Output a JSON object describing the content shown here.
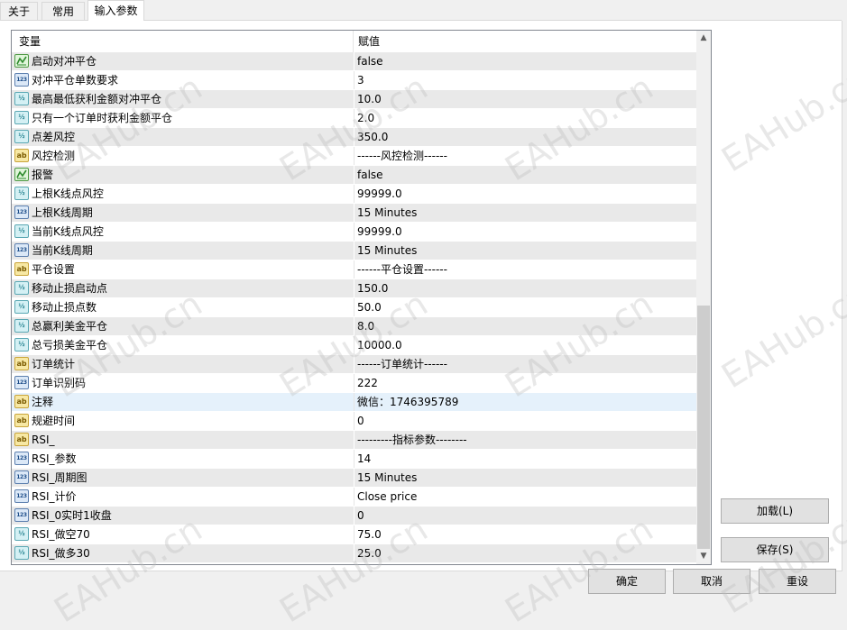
{
  "tabs": [
    {
      "label": "关于"
    },
    {
      "label": "常用"
    },
    {
      "label": "输入参数"
    }
  ],
  "grid": {
    "header": {
      "variable": "变量",
      "value": "赋值"
    },
    "rows": [
      {
        "icon": "bool",
        "name": "启动对冲平仓",
        "value": "false"
      },
      {
        "icon": "int",
        "name": "对冲平仓单数要求",
        "value": "3"
      },
      {
        "icon": "double",
        "name": "最高最低获利金额对冲平仓",
        "value": "10.0"
      },
      {
        "icon": "double",
        "name": "只有一个订单时获利金额平仓",
        "value": "2.0"
      },
      {
        "icon": "double",
        "name": "点差风控",
        "value": "350.0"
      },
      {
        "icon": "string",
        "name": "风控检测",
        "value": "------风控检测------"
      },
      {
        "icon": "bool",
        "name": "报警",
        "value": "false"
      },
      {
        "icon": "double",
        "name": "上根K线点风控",
        "value": "99999.0"
      },
      {
        "icon": "int",
        "name": "上根K线周期",
        "value": "15 Minutes"
      },
      {
        "icon": "double",
        "name": "当前K线点风控",
        "value": "99999.0"
      },
      {
        "icon": "int",
        "name": "当前K线周期",
        "value": "15 Minutes"
      },
      {
        "icon": "string",
        "name": "平仓设置",
        "value": "------平仓设置------"
      },
      {
        "icon": "double",
        "name": "移动止损启动点",
        "value": "150.0"
      },
      {
        "icon": "double",
        "name": "移动止损点数",
        "value": "50.0"
      },
      {
        "icon": "double",
        "name": "总赢利美金平仓",
        "value": "8.0"
      },
      {
        "icon": "double",
        "name": "总亏损美金平仓",
        "value": "10000.0"
      },
      {
        "icon": "string",
        "name": "订单统计",
        "value": "------订单统计------"
      },
      {
        "icon": "int",
        "name": "订单识别码",
        "value": "222"
      },
      {
        "icon": "string",
        "name": "注释",
        "value": "微信：1746395789",
        "selected": true
      },
      {
        "icon": "string",
        "name": "规避时间",
        "value": "0"
      },
      {
        "icon": "string",
        "name": "RSI_",
        "value": "---------指标参数--------"
      },
      {
        "icon": "int",
        "name": "RSI_参数",
        "value": "14"
      },
      {
        "icon": "int",
        "name": "RSI_周期图",
        "value": "15 Minutes"
      },
      {
        "icon": "int",
        "name": "RSI_计价",
        "value": "Close price"
      },
      {
        "icon": "int",
        "name": "RSI_0实时1收盘",
        "value": "0"
      },
      {
        "icon": "double",
        "name": "RSI_做空70",
        "value": "75.0"
      },
      {
        "icon": "double",
        "name": "RSI_做多30",
        "value": "25.0"
      }
    ]
  },
  "icons": {
    "int": "123",
    "double": "½",
    "string": "ab",
    "bool": "bool-icon"
  },
  "buttons": {
    "load": "加载(L)",
    "save": "保存(S)",
    "ok": "确定",
    "cancel": "取消",
    "reset": "重设"
  },
  "watermark": "EAHub.cn"
}
